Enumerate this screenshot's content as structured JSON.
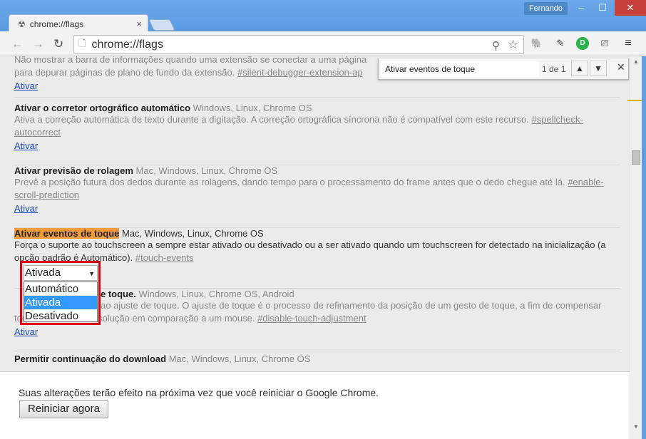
{
  "window": {
    "user": "Fernando",
    "tab_title": "chrome://flags",
    "url": "chrome://flags"
  },
  "icons": {
    "tab": "flag-radiation-icon",
    "back": "arrow-left-icon",
    "forward": "arrow-right-icon",
    "reload": "reload-icon",
    "page": "page-icon",
    "zoom": "magnifier-icon",
    "bookmark": "star-icon",
    "ext1": "evernote-icon",
    "ext2": "pen-icon",
    "ext3": "green-circle-icon",
    "cast": "cast-icon",
    "menu": "hamburger-menu-icon"
  },
  "find": {
    "query": "Ativar eventos de toque",
    "count": "1 de 1",
    "prev": "▲",
    "next": "▼",
    "close": "✕"
  },
  "flags": [
    {
      "desc": "Não mostrar a barra de informações quando uma extensão se conectar a uma página",
      "desc2": "para depurar páginas de plano de fundo da extensão.",
      "link": "#silent-debugger-extension-ap",
      "action": "Ativar"
    },
    {
      "title": "Ativar o corretor ortográfico automático",
      "platforms": "Windows, Linux, Chrome OS",
      "desc": "Ativa a correção automática de texto durante a digitação. A correção ortográfica síncrona não é compatível com este recurso.",
      "link1": "#spellcheck-",
      "link2": "autocorrect",
      "action": "Ativar"
    },
    {
      "title": "Ativar previsão de rolagem",
      "platforms": "Mac, Windows, Linux, Chrome OS",
      "desc": "Prevê a posição futura dos dedos durante as rolagens, dando tempo para o processamento do frame antes que o dedo chegue até lá.",
      "link1": "#enable-",
      "link2": "scroll-prediction",
      "action": "Ativar"
    },
    {
      "title": "Ativar eventos de toque",
      "platforms": "Mac, Windows, Linux, Chrome OS",
      "desc": "Força o suporte ao touchscreen a sempre estar ativado ou desativado ou a ser ativado quando um touchscreen for detectado na inicialização (a",
      "desc2": "opção padrão é Automático).",
      "link": "#touch-events",
      "select_value": "Ativada",
      "options": [
        "Automático",
        "Ativada",
        "Desativado"
      ]
    },
    {
      "title_suffix": "e toque.",
      "platforms": "Windows, Linux, Chrome OS, Android",
      "desc": "ao ajuste de toque. O ajuste de toque é o processo de refinamento da posição de um gesto de toque, a fim de compensar",
      "desc2": "toques com baixa resolução em comparação a um mouse.",
      "link": "#disable-touch-adjustment",
      "action": "Ativar"
    },
    {
      "title": "Permitir continuação do download",
      "platforms": "Mac, Windows, Linux, Chrome OS"
    }
  ],
  "bottom": {
    "message": "Suas alterações terão efeito na próxima vez que você reiniciar o Google Chrome.",
    "restart": "Reiniciar agora"
  }
}
